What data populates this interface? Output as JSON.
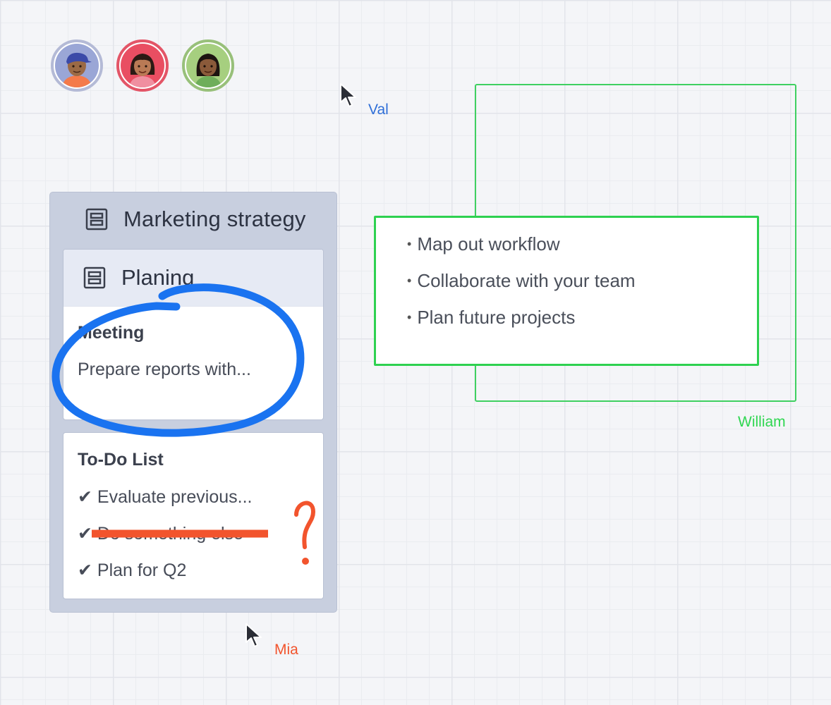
{
  "collaborators": [
    {
      "id": "avatar-1",
      "ring_color": "#b4bad6",
      "bg_color": "#9aa6d6"
    },
    {
      "id": "avatar-2",
      "ring_color": "#e35567",
      "bg_color": "#e94e62"
    },
    {
      "id": "avatar-3",
      "ring_color": "#98c07a",
      "bg_color": "#a6cf7f"
    }
  ],
  "cursors": [
    {
      "name": "Val",
      "color": "#2f6fd8"
    },
    {
      "name": "Mia",
      "color": "#f2542d"
    },
    {
      "name": "William",
      "color": "#2fd651"
    }
  ],
  "board": {
    "title": "Marketing strategy",
    "icon": "kanban-board-icon",
    "cards": [
      {
        "header": "Planing",
        "title": "Meeting",
        "text": "Prepare reports with..."
      },
      {
        "title": "To-Do List",
        "items": [
          "✔ Evaluate previous...",
          "✔ Do something else",
          "✔ Plan for Q2"
        ]
      }
    ]
  },
  "list_box": {
    "items": [
      "Map out workflow",
      "Collaborate with your team",
      "Plan future projects"
    ],
    "border_color": "#2ed150"
  },
  "annotations": {
    "question_mark": "?",
    "circle_color": "#1a73f0",
    "strike_color": "#f2542d"
  }
}
